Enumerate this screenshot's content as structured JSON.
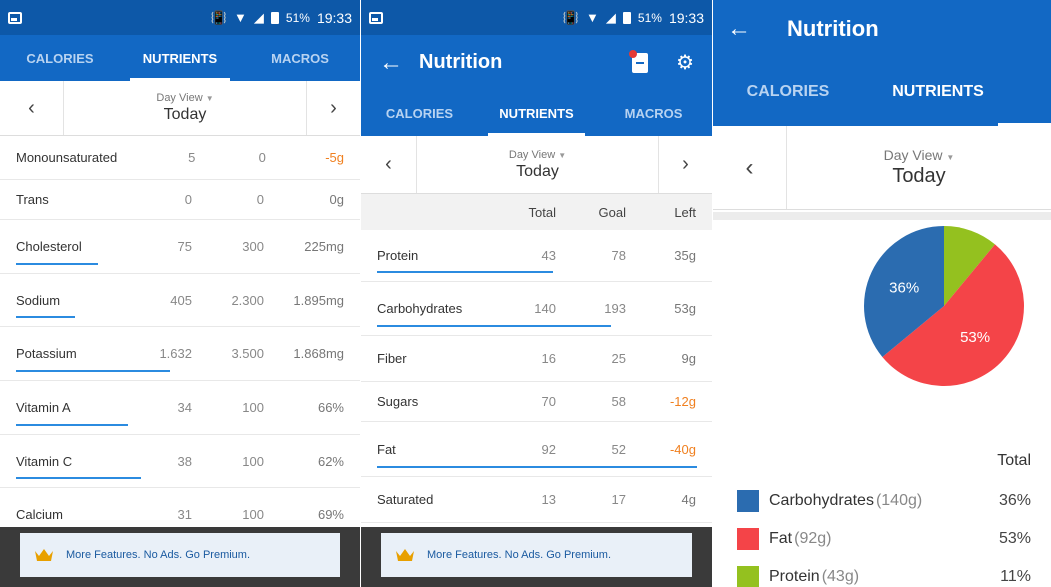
{
  "status": {
    "battery": "51%",
    "time": "19:33"
  },
  "tabs": [
    "CALORIES",
    "NUTRIENTS",
    "MACROS"
  ],
  "title": "Nutrition",
  "day": {
    "view": "Day View",
    "date": "Today"
  },
  "panel1": {
    "rows": [
      {
        "name": "Monounsaturated",
        "total": "5",
        "goal": "0",
        "left": "-5g",
        "neg": true,
        "progress": 0
      },
      {
        "name": "Trans",
        "total": "0",
        "goal": "0",
        "left": "0g",
        "neg": false,
        "progress": 0
      },
      {
        "name": "Cholesterol",
        "total": "75",
        "goal": "300",
        "left": "225mg",
        "neg": false,
        "progress": 0.25
      },
      {
        "name": "Sodium",
        "total": "405",
        "goal": "2.300",
        "left": "1.895mg",
        "neg": false,
        "progress": 0.18
      },
      {
        "name": "Potassium",
        "total": "1.632",
        "goal": "3.500",
        "left": "1.868mg",
        "neg": false,
        "progress": 0.47
      },
      {
        "name": "Vitamin A",
        "total": "34",
        "goal": "100",
        "left": "66%",
        "neg": false,
        "progress": 0.34
      },
      {
        "name": "Vitamin C",
        "total": "38",
        "goal": "100",
        "left": "62%",
        "neg": false,
        "progress": 0.38
      },
      {
        "name": "Calcium",
        "total": "31",
        "goal": "100",
        "left": "69%",
        "neg": false,
        "progress": 0.31
      }
    ]
  },
  "panel2": {
    "headers": {
      "total": "Total",
      "goal": "Goal",
      "left": "Left"
    },
    "rows": [
      {
        "name": "Protein",
        "total": "43",
        "goal": "78",
        "left": "35g",
        "neg": false,
        "progress": 0.55
      },
      {
        "name": "Carbohydrates",
        "total": "140",
        "goal": "193",
        "left": "53g",
        "neg": false,
        "progress": 0.73
      },
      {
        "name": "Fiber",
        "total": "16",
        "goal": "25",
        "left": "9g",
        "neg": false,
        "progress": 0
      },
      {
        "name": "Sugars",
        "total": "70",
        "goal": "58",
        "left": "-12g",
        "neg": true,
        "progress": 0
      },
      {
        "name": "Fat",
        "total": "92",
        "goal": "52",
        "left": "-40g",
        "neg": true,
        "progress": 1
      },
      {
        "name": "Saturated",
        "total": "13",
        "goal": "17",
        "left": "4g",
        "neg": false,
        "progress": 0
      }
    ]
  },
  "banner": {
    "text": "More Features. No Ads. Go Premium."
  },
  "macros": {
    "total_label": "Total",
    "items": [
      {
        "name": "Carbohydrates",
        "amount": "(140g)",
        "pct": "36%",
        "value": 36,
        "color": "#2b6cb0"
      },
      {
        "name": "Fat",
        "amount": "(92g)",
        "pct": "53%",
        "value": 53,
        "color": "#f44448"
      },
      {
        "name": "Protein",
        "amount": "(43g)",
        "pct": "11%",
        "value": 11,
        "color": "#94c11f"
      }
    ]
  },
  "colors": {
    "statusbar": "#0d58a8",
    "appbar": "#1268c4",
    "accent_bar": "#2b8be0",
    "negative": "#f08020"
  }
}
